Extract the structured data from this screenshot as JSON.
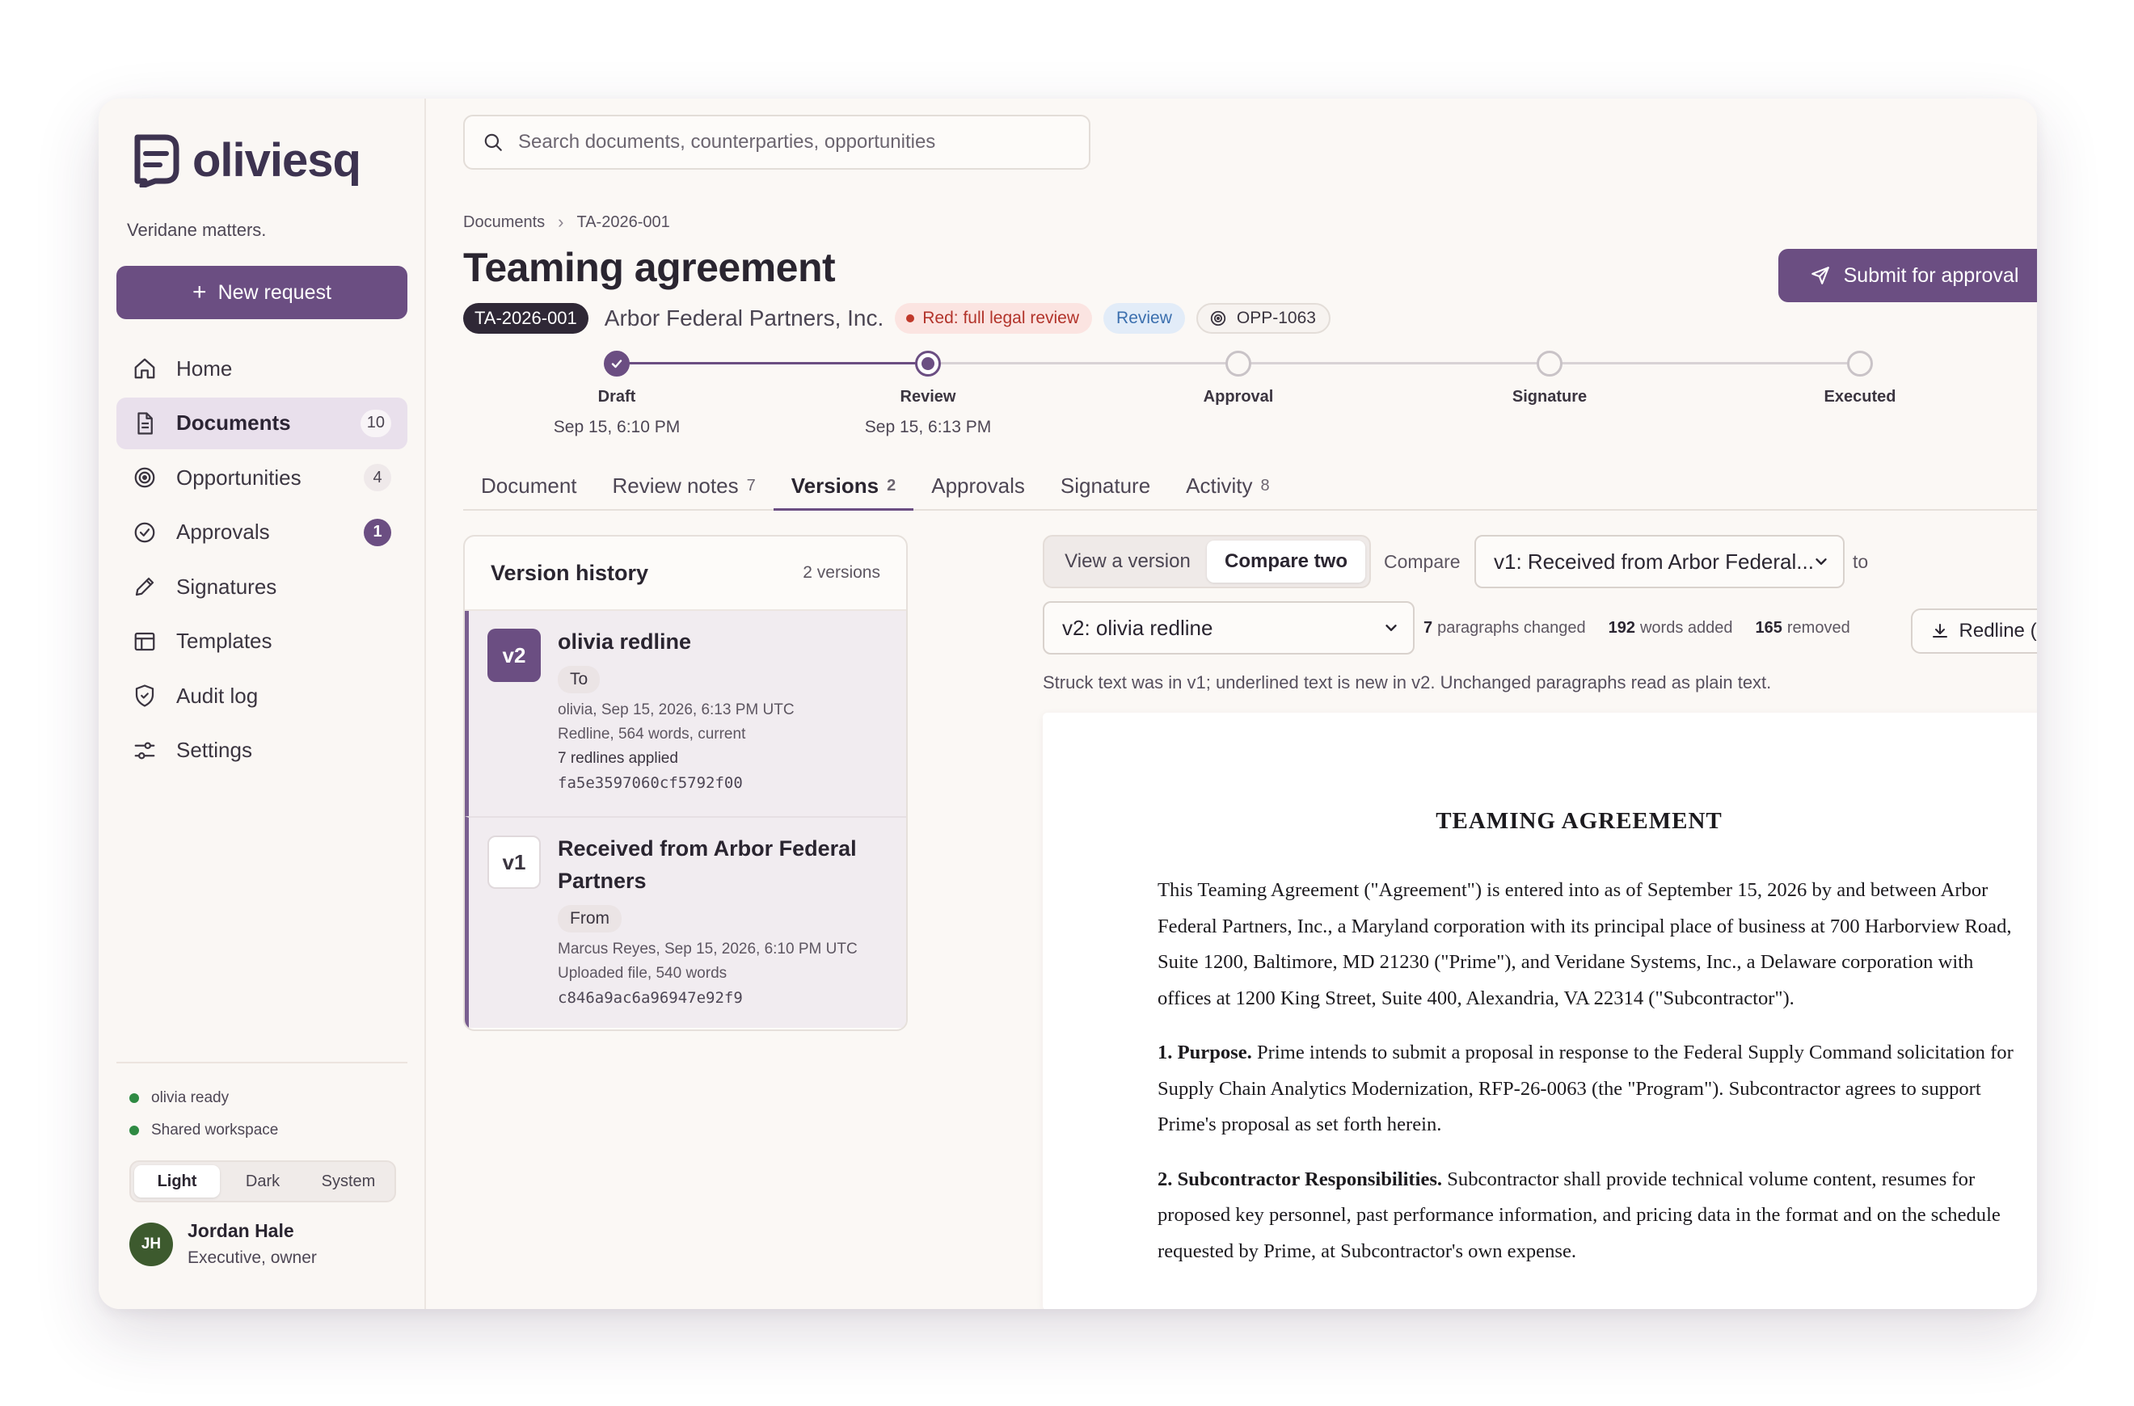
{
  "app": {
    "name": "oliviesq",
    "workspace": "Veridane matters."
  },
  "sidebar": {
    "new_request": "New request",
    "items": [
      {
        "label": "Home",
        "icon": "home-icon"
      },
      {
        "label": "Documents",
        "icon": "document-icon",
        "count": "10",
        "active": true
      },
      {
        "label": "Opportunities",
        "icon": "target-icon",
        "count": "4"
      },
      {
        "label": "Approvals",
        "icon": "check-circle-icon",
        "count": "1"
      },
      {
        "label": "Signatures",
        "icon": "pen-icon"
      },
      {
        "label": "Templates",
        "icon": "layout-icon"
      },
      {
        "label": "Audit log",
        "icon": "shield-icon"
      },
      {
        "label": "Settings",
        "icon": "sliders-icon"
      }
    ],
    "status": [
      "olivia ready",
      "Shared workspace"
    ],
    "theme_options": [
      "Light",
      "Dark",
      "System"
    ],
    "theme_selected": "Light",
    "user": {
      "initials": "JH",
      "name": "Jordan Hale",
      "role": "Executive, owner"
    }
  },
  "search": {
    "placeholder": "Search documents, counterparties, opportunities"
  },
  "breadcrumb": [
    "Documents",
    "TA-2026-001"
  ],
  "document": {
    "title": "Teaming agreement",
    "id": "TA-2026-001",
    "counterparty": "Arbor Federal Partners, Inc.",
    "risk": "Red: full legal review",
    "stage": "Review",
    "opportunity": "OPP-1063"
  },
  "actions": {
    "submit": "Submit for approval"
  },
  "stepper": [
    {
      "label": "Draft",
      "date": "Sep 15, 6:10 PM",
      "state": "done"
    },
    {
      "label": "Review",
      "date": "Sep 15, 6:13 PM",
      "state": "current"
    },
    {
      "label": "Approval",
      "date": "",
      "state": "future"
    },
    {
      "label": "Signature",
      "date": "",
      "state": "future"
    },
    {
      "label": "Executed",
      "date": "",
      "state": "future"
    }
  ],
  "tabs": [
    {
      "label": "Document",
      "count": ""
    },
    {
      "label": "Review notes",
      "count": "7"
    },
    {
      "label": "Versions",
      "count": "2",
      "active": true
    },
    {
      "label": "Approvals",
      "count": ""
    },
    {
      "label": "Signature",
      "count": ""
    },
    {
      "label": "Activity",
      "count": "8"
    }
  ],
  "version_history": {
    "title": "Version history",
    "count": "2 versions",
    "versions": [
      {
        "badge": "v2",
        "name": "olivia redline",
        "tag": "To",
        "meta": [
          "olivia, Sep 15, 2026, 6:13 PM UTC",
          "Redline, 564 words, current"
        ],
        "note": "7 redlines applied",
        "hash": "fa5e3597060cf5792f00"
      },
      {
        "badge": "v1",
        "name": "Received from Arbor Federal Partners",
        "tag": "From",
        "meta": [
          "Marcus Reyes, Sep 15, 2026, 6:10 PM UTC",
          "Uploaded file, 540 words"
        ],
        "note": "",
        "hash": "c846a9ac6a96947e92f9"
      }
    ]
  },
  "compare": {
    "view_options": [
      "View a version",
      "Compare two"
    ],
    "view_selected": "Compare two",
    "label": "Compare",
    "from": "v1: Received from Arbor Federal...",
    "to_label": "to",
    "to": "v2: olivia redline",
    "stats": {
      "paragraphs": "7",
      "paragraphs_label": "paragraphs changed",
      "added": "192",
      "added_label": "words added",
      "removed": "165",
      "removed_label": "removed"
    },
    "redline_button": "Redline (Word)",
    "hint": "Struck text was in v1; underlined text is new in v2. Unchanged paragraphs read as plain text."
  },
  "doc_preview": {
    "title": "TEAMING AGREEMENT",
    "intro": "This Teaming Agreement (\"Agreement\") is entered into as of September 15, 2026 by and between Arbor Federal Partners, Inc., a Maryland corporation with its principal place of business at 700 Harborview Road, Suite 1200, Baltimore, MD 21230 (\"Prime\"), and Veridane Systems, Inc., a Delaware corporation with offices at 1200 King Street, Suite 400, Alexandria, VA 22314 (\"Subcontractor\").",
    "sections": [
      {
        "heading": "1. Purpose.",
        "text": "Prime intends to submit a proposal in response to the Federal Supply Command solicitation for Supply Chain Analytics Modernization, RFP-26-0063 (the \"Program\"). Subcontractor agrees to support Prime's proposal as set forth herein."
      },
      {
        "heading": "2. Subcontractor Responsibilities.",
        "text": "Subcontractor shall provide technical volume content, resumes for proposed key personnel, past performance information, and pricing data in the format and on the schedule requested by Prime, at Subcontractor's own expense."
      }
    ]
  },
  "colors": {
    "accent": "#6b4e82",
    "risk_red": "#c0392b",
    "stage_blue": "#3b6fae",
    "status_green": "#2f8a43"
  }
}
